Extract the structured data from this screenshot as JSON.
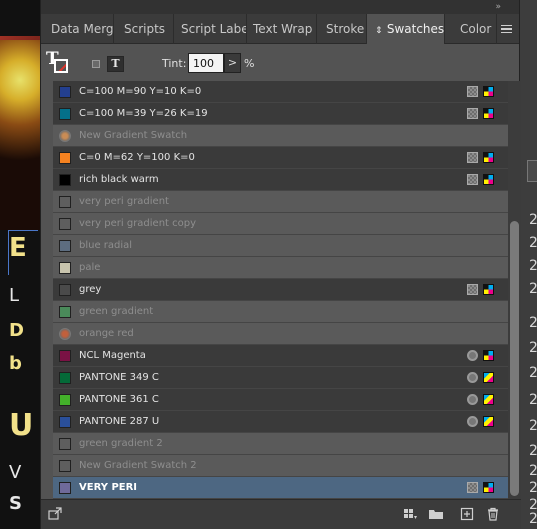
{
  "background": {
    "doc_letters": [
      "E",
      "L",
      "D",
      "b",
      "U",
      "V",
      "S"
    ],
    "right_strip_numbers": [
      "2",
      "2",
      "2",
      "2",
      "2",
      "2",
      "2",
      "2",
      "2",
      "2",
      "2",
      "2",
      "2",
      "2"
    ]
  },
  "tabs": [
    {
      "id": "data-merge",
      "label": "Data Merge",
      "active": false
    },
    {
      "id": "scripts",
      "label": "Scripts",
      "active": false
    },
    {
      "id": "script-label",
      "label": "Script Label",
      "active": false
    },
    {
      "id": "text-wrap",
      "label": "Text Wrap",
      "active": false
    },
    {
      "id": "stroke",
      "label": "Stroke",
      "active": false
    },
    {
      "id": "swatches",
      "label": "Swatches",
      "active": true,
      "icon": "up-down-arrows-icon"
    },
    {
      "id": "color",
      "label": "Color",
      "active": false
    }
  ],
  "panel_menu_icon": "hamburger-icon",
  "collapse_glyph": "»",
  "controls": {
    "fill_stroke_glyph": "T",
    "text_button_glyph": "T",
    "tint_label": "Tint:",
    "tint_value": "100",
    "tint_arrow": ">",
    "tint_unit": "%"
  },
  "swatches": [
    {
      "name": "C=100 M=90 Y=10 K=0",
      "color": "#233f8f",
      "state": "normal",
      "chip": "square",
      "icons": [
        "nonprint",
        "cmyk"
      ]
    },
    {
      "name": "C=100 M=39 Y=26 K=19",
      "color": "#04708a",
      "state": "normal",
      "chip": "square",
      "icons": [
        "nonprint",
        "cmyk"
      ]
    },
    {
      "name": "New Gradient Swatch",
      "color": "#c98c55",
      "state": "dim",
      "chip": "gradient",
      "icons": []
    },
    {
      "name": "C=0 M=62 Y=100 K=0",
      "color": "#f58220",
      "state": "normal",
      "chip": "square",
      "icons": [
        "nonprint",
        "cmyk"
      ]
    },
    {
      "name": "rich black warm",
      "color": "#000000",
      "state": "normal",
      "chip": "square",
      "icons": [
        "nonprint",
        "cmyk"
      ]
    },
    {
      "name": "very peri gradient",
      "color": "#5e5e5e",
      "state": "dim",
      "chip": "square",
      "icons": []
    },
    {
      "name": "very peri gradient copy",
      "color": "#5e5e5e",
      "state": "dim",
      "chip": "square",
      "icons": []
    },
    {
      "name": "blue radial",
      "color": "#5d6d80",
      "state": "dim",
      "chip": "square",
      "icons": []
    },
    {
      "name": "pale",
      "color": "#c8c4ad",
      "state": "dim",
      "chip": "square",
      "icons": []
    },
    {
      "name": "grey",
      "color": "#4a4a4a",
      "state": "normal",
      "chip": "square",
      "icons": [
        "nonprint",
        "cmyk"
      ]
    },
    {
      "name": "green gradient",
      "color": "#4a8a5a",
      "state": "dim",
      "chip": "square",
      "icons": []
    },
    {
      "name": "orange red",
      "color": "#c2603c",
      "state": "dim",
      "chip": "gradient",
      "icons": []
    },
    {
      "name": "NCL Magenta",
      "color": "#7a1244",
      "state": "normal",
      "chip": "square",
      "icons": [
        "spot",
        "cmyk"
      ]
    },
    {
      "name": "PANTONE 349 C",
      "color": "#046a38",
      "state": "normal",
      "chip": "square",
      "icons": [
        "spot",
        "rgb"
      ]
    },
    {
      "name": "PANTONE 361 C",
      "color": "#43b02a",
      "state": "normal",
      "chip": "square",
      "icons": [
        "spot",
        "rgb"
      ]
    },
    {
      "name": "PANTONE 287 U",
      "color": "#2a4f9a",
      "state": "normal",
      "chip": "square",
      "icons": [
        "spot",
        "rgb"
      ]
    },
    {
      "name": "green gradient 2",
      "color": "#5e5e5e",
      "state": "dim",
      "chip": "square",
      "icons": []
    },
    {
      "name": "New Gradient Swatch 2",
      "color": "#5e5e5e",
      "state": "dim",
      "chip": "square",
      "icons": []
    },
    {
      "name": "VERY PERI",
      "color": "#6f6a9a",
      "state": "selected",
      "chip": "square",
      "icons": [
        "nonprint",
        "cmyk"
      ]
    }
  ],
  "bottom_bar": {
    "icons": [
      "show-swatch-kinds-icon",
      "swatch-views-icon",
      "new-color-group-icon",
      "new-swatch-icon",
      "trash-icon"
    ]
  }
}
